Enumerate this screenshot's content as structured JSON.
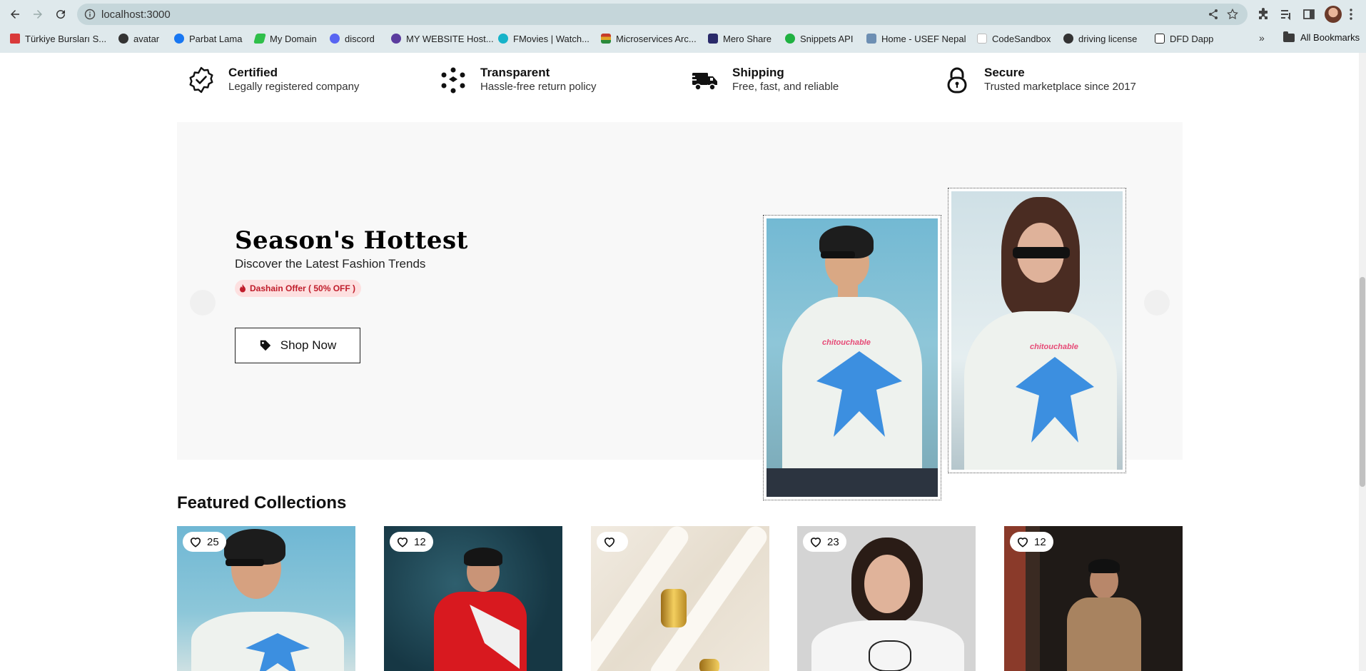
{
  "browser": {
    "url": "localhost:3000",
    "bookmarks": [
      {
        "label": "Türkiye Bursları S...",
        "icon": "turkiye-burslari-favicon",
        "color": "#d93a3a"
      },
      {
        "label": "avatar",
        "icon": "globe-icon",
        "color": "#333333"
      },
      {
        "label": "Parbat Lama",
        "icon": "facebook-favicon",
        "color": "#1877f2"
      },
      {
        "label": "My Domain",
        "icon": "hashnode-favicon",
        "color": "#2fbf4a"
      },
      {
        "label": "discord",
        "icon": "discord-favicon",
        "color": "#5865f2"
      },
      {
        "label": "MY WEBSITE Host...",
        "icon": "hosting-favicon",
        "color": "#5b3c9e"
      },
      {
        "label": "FMovies | Watch...",
        "icon": "fmovies-favicon",
        "color": "#16b3c9"
      },
      {
        "label": "Microservices Arc...",
        "icon": "stack-favicon",
        "color": "#c63b2b"
      },
      {
        "label": "Mero Share",
        "icon": "mero-share-favicon",
        "color": "#2a2a6a"
      },
      {
        "label": "Snippets API",
        "icon": "snippets-favicon",
        "color": "#1fb141"
      },
      {
        "label": "Home - USEF Nepal",
        "icon": "usef-favicon",
        "color": "#6d8fb3"
      },
      {
        "label": "CodeSandbox",
        "icon": "codesandbox-favicon",
        "color": "#e6e6e6"
      },
      {
        "label": "driving license",
        "icon": "globe-icon",
        "color": "#333333"
      },
      {
        "label": "DFD Dapp",
        "icon": "notion-favicon",
        "color": "#222222"
      }
    ],
    "more_bookmarks": "»",
    "all_bookmarks": "All Bookmarks"
  },
  "features": [
    {
      "title": "Certified",
      "desc": "Legally registered company",
      "icon": "certified-badge-icon"
    },
    {
      "title": "Transparent",
      "desc": "Hassle-free return policy",
      "icon": "transparent-cycle-icon"
    },
    {
      "title": "Shipping",
      "desc": "Free, fast, and reliable",
      "icon": "delivery-truck-icon"
    },
    {
      "title": "Secure",
      "desc": "Trusted marketplace since 2017",
      "icon": "lock-icon"
    }
  ],
  "hero": {
    "title": "Season's Hottest",
    "subtitle": "Discover the Latest Fashion Trends",
    "badge": "Dashain Offer ( 50% OFF )",
    "button": "Shop Now",
    "shirt_text": "chitouchable"
  },
  "featured": {
    "title": "Featured Collections",
    "items": [
      {
        "likes": "25"
      },
      {
        "likes": "12"
      },
      {
        "likes": ""
      },
      {
        "likes": "23"
      },
      {
        "likes": "12"
      }
    ]
  },
  "colors": {
    "badge_bg": "#fde0e0",
    "badge_text": "#c01d2b",
    "hero_bg": "#f8f8f8"
  }
}
